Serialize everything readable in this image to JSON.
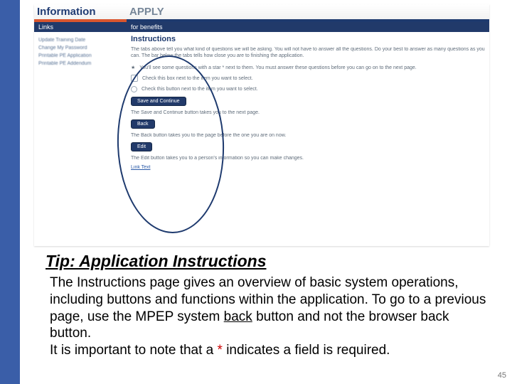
{
  "screenshot": {
    "header_left": "Information",
    "header_right": "APPLY",
    "sub_left": "Links",
    "sub_right": "for benefits",
    "sidebar": {
      "items": [
        "Update Training Date",
        "Change My Password",
        "Printable PE Application",
        "Printable PE Addendum"
      ]
    },
    "main": {
      "heading": "Instructions",
      "intro": "The tabs above tell you what kind of questions we will be asking. You will not have to answer all the questions. Do your best to answer as many questions as you can. The bar below the tabs tells how close you are to finishing the application.",
      "star_line": "You'll see some questions with a star * next to them. You must answer these questions before you can go on to the next page.",
      "check_line": "Check this box next to the item you want to select.",
      "radio_line": "Check this button next to the item you want to select.",
      "save_btn": "Save and Continue",
      "save_line": "The Save and Continue button takes you to the next page.",
      "back_btn": "Back",
      "back_line": "The Back button takes you to the page before the one you are on now.",
      "edit_btn": "Edit",
      "edit_line": "The Edit button takes you to a person's information so you can make changes.",
      "link_text": "Link Text"
    }
  },
  "tip": {
    "title": "Tip: Application Instructions",
    "body_1": "The Instructions page gives an overview of basic system operations, including buttons and functions within the application.  To go to a previous page, use the MPEP system ",
    "body_back": "back",
    "body_2": " button and not the browser back button.",
    "body_3a": "It is important to note that a ",
    "body_star": "*",
    "body_3b": " indicates a field is required."
  },
  "page_number": "45"
}
